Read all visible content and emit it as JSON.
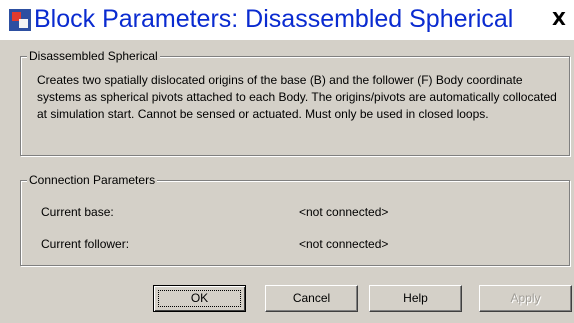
{
  "window": {
    "title": "Block Parameters: Disassembled Spherical",
    "close_label": "X"
  },
  "description_group": {
    "title": "Disassembled Spherical",
    "text": "Creates two spatially dislocated origins of the base (B) and the follower (F) Body coordinate systems as spherical pivots attached to each Body. The origins/pivots are automatically collocated at simulation start. Cannot be sensed or actuated. Must only be used in closed loops."
  },
  "connection_group": {
    "title": "Connection Parameters",
    "rows": [
      {
        "label": "Current base:",
        "value": "<not connected>"
      },
      {
        "label": "Current follower:",
        "value": "<not connected>"
      }
    ]
  },
  "buttons": {
    "ok": "OK",
    "cancel": "Cancel",
    "help": "Help",
    "apply": "Apply"
  },
  "icons": {
    "title_icon": "simulink-block-icon",
    "close_icon": "close-icon"
  }
}
